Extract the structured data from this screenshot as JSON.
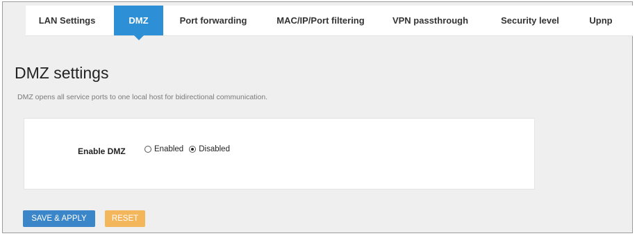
{
  "tabs": [
    {
      "label": "LAN Settings",
      "active": false
    },
    {
      "label": "DMZ",
      "active": true
    },
    {
      "label": "Port forwarding",
      "active": false
    },
    {
      "label": "MAC/IP/Port filtering",
      "active": false
    },
    {
      "label": "VPN passthrough",
      "active": false
    },
    {
      "label": "Security level",
      "active": false
    },
    {
      "label": "Upnp",
      "active": false
    }
  ],
  "page": {
    "title": "DMZ settings",
    "description": "DMZ opens all service ports to one local host for bidirectional communication."
  },
  "form": {
    "enable_dmz_label": "Enable DMZ",
    "options": [
      {
        "label": "Enabled",
        "checked": false
      },
      {
        "label": "Disabled",
        "checked": true
      }
    ]
  },
  "buttons": {
    "save_label": "SAVE & APPLY",
    "reset_label": "RESET"
  },
  "colors": {
    "active_tab": "#2d8fd6",
    "save_button": "#3a86c8",
    "reset_button": "#f3b65b",
    "background": "#efefef"
  }
}
